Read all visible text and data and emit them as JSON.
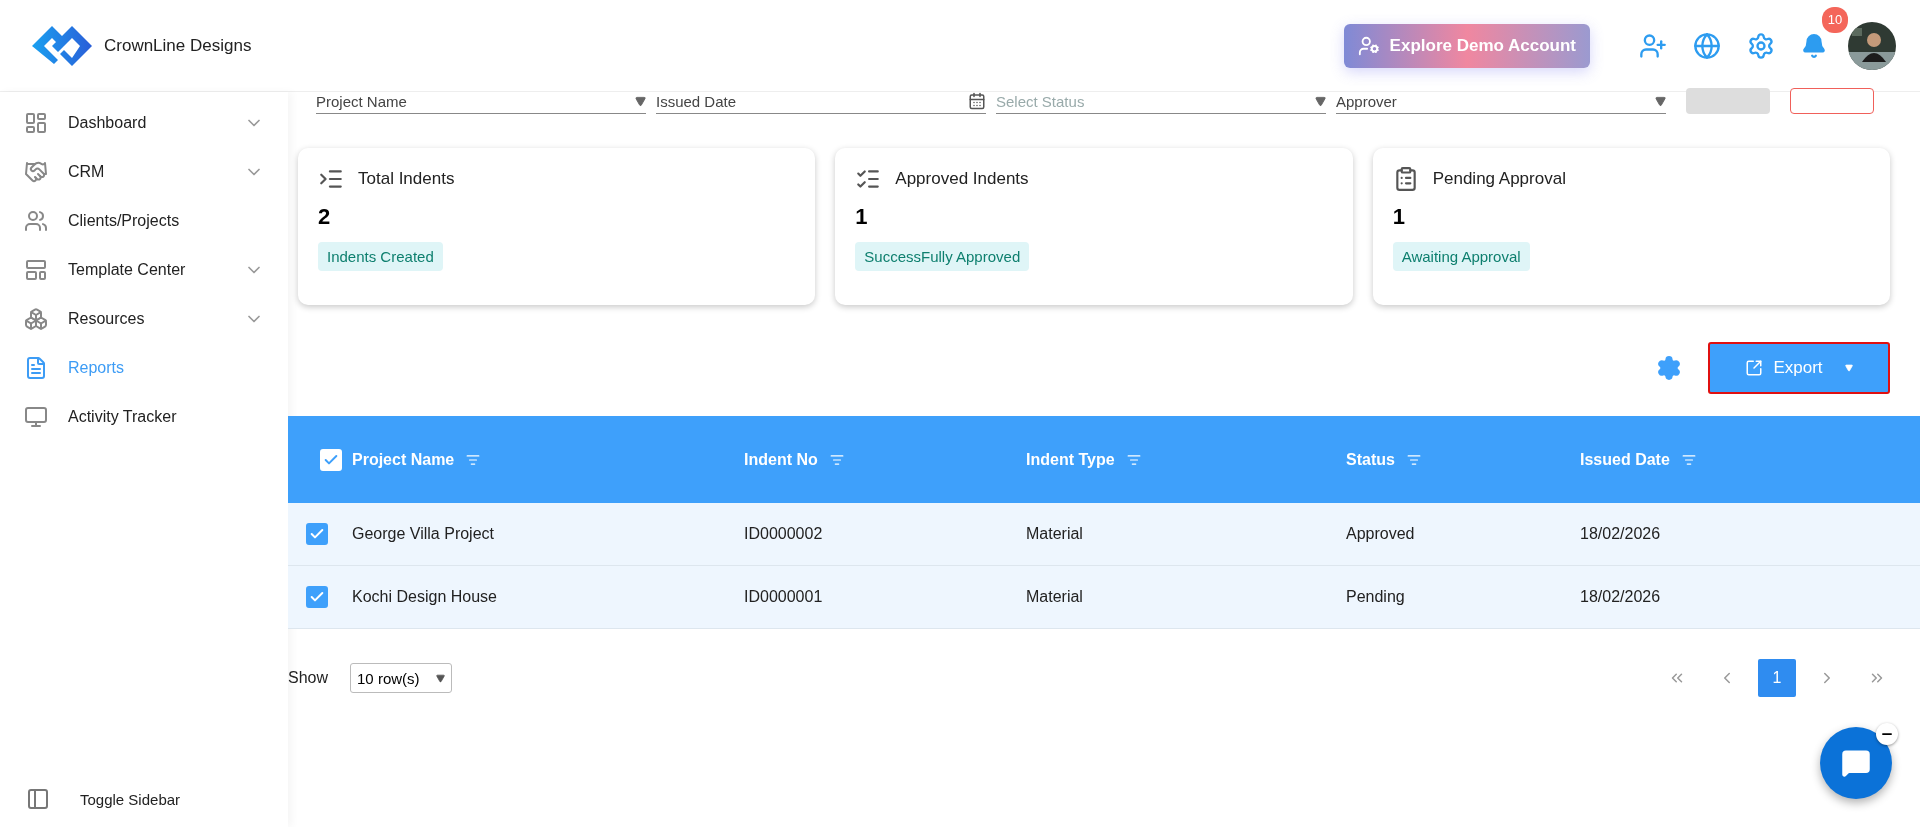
{
  "header": {
    "logo_text": "CrownLine Designs",
    "demo_button": "Explore Demo Account",
    "notification_count": "10"
  },
  "sidebar": {
    "items": [
      {
        "label": "Dashboard",
        "selected": false,
        "expandable": true
      },
      {
        "label": "CRM",
        "selected": false,
        "expandable": true
      },
      {
        "label": "Clients/Projects",
        "selected": false,
        "expandable": false
      },
      {
        "label": "Template Center",
        "selected": false,
        "expandable": true
      },
      {
        "label": "Resources",
        "selected": false,
        "expandable": true
      },
      {
        "label": "Reports",
        "selected": true,
        "expandable": false
      },
      {
        "label": "Activity Tracker",
        "selected": false,
        "expandable": false
      }
    ],
    "toggle": "Toggle Sidebar"
  },
  "filters": [
    {
      "kind": "dropdown",
      "value": "Project Name"
    },
    {
      "kind": "date",
      "value": "Issued Date"
    },
    {
      "kind": "dropdown",
      "placeholder": "Select Status"
    },
    {
      "kind": "dropdown",
      "value": "Approver"
    }
  ],
  "stats": [
    {
      "title": "Total Indents",
      "value": "2",
      "badge": "Indents Created"
    },
    {
      "title": "Approved Indents",
      "value": "1",
      "badge": "SuccessFully Approved"
    },
    {
      "title": "Pending Approval",
      "value": "1",
      "badge": "Awaiting Approval"
    }
  ],
  "toolbar": {
    "export": "Export",
    "highlighted": true
  },
  "table": {
    "all_checked": true,
    "columns": [
      "Project Name",
      "Indent No",
      "Indent Type",
      "Status",
      "Issued Date"
    ],
    "rows": [
      {
        "checked": true,
        "cells": [
          "George Villa Project",
          "ID0000002",
          "Material",
          "Approved",
          "18/02/2026"
        ]
      },
      {
        "checked": true,
        "cells": [
          "Kochi Design House",
          "ID0000001",
          "Material",
          "Pending",
          "18/02/2026"
        ]
      }
    ]
  },
  "pagination": {
    "show_label": "Show",
    "rows_option": "10 row(s)",
    "pages": [
      {
        "label": "1",
        "selected": true
      }
    ]
  }
}
